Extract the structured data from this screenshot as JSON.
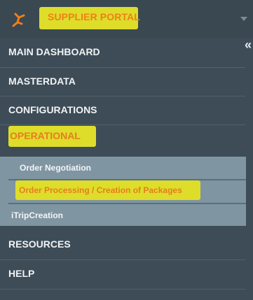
{
  "brand": {
    "name": "SUPPLIER PORTAL",
    "logo_icon": "running-figure-icon"
  },
  "menu": {
    "main_dashboard": "MAIN DASHBOARD",
    "masterdata": "MASTERDATA",
    "configurations": "CONFIGURATIONS",
    "operational": "OPERATIONAL",
    "resources": "RESOURCES",
    "help": "HELP"
  },
  "submenu": {
    "order_negotiation": "Order Negotiation",
    "order_processing": "Order Processing / Creation of Packages",
    "itrip_creation": "iTripCreation"
  },
  "colors": {
    "highlight": "#dedd2a",
    "highlight_text": "#e67d20",
    "sidebar_bg": "#3d4c57",
    "submenu_bg": "#7f95a2"
  }
}
